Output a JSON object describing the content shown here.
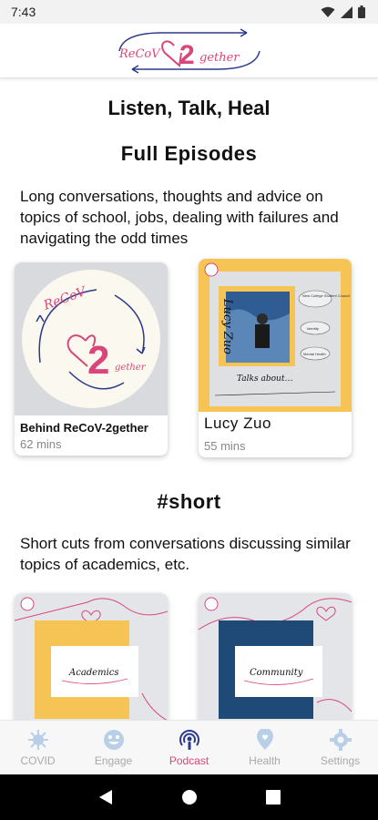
{
  "status_bar": {
    "time": "7:43"
  },
  "header": {
    "logo_left": "ReCoV",
    "logo_num": "2",
    "logo_right": "gether"
  },
  "main": {
    "title": "Listen, Talk, Heal",
    "full_episodes": {
      "heading": "Full Episodes",
      "description": "Long conversations, thoughts and advice on topics of school, jobs, dealing with failures and navigating the odd times",
      "cards": [
        {
          "title": "Behind ReCoV-2gether",
          "duration": "62 mins",
          "art_left": "ReCoV",
          "art_num": "2",
          "art_right": "gether"
        },
        {
          "title": "Lucy Zuo",
          "duration": "55 mins",
          "art_name": "Lucy Zuo",
          "art_caption": "Talks about…",
          "art_bubbles": [
            "New College Student Council",
            "Identity",
            "Mental Health"
          ]
        }
      ]
    },
    "short": {
      "heading": "#short",
      "description": "Short cuts from conversations discussing similar topics of academics, etc.",
      "cards": [
        {
          "label": "Academics",
          "accent": "#f6c455"
        },
        {
          "label": "Community",
          "accent": "#1f4a78"
        }
      ]
    }
  },
  "bottom_nav": {
    "items": [
      {
        "label": "COVID",
        "icon": "virus-icon",
        "active": false
      },
      {
        "label": "Engage",
        "icon": "emoji-icon",
        "active": false
      },
      {
        "label": "Podcast",
        "icon": "podcast-icon",
        "active": true
      },
      {
        "label": "Health",
        "icon": "health-icon",
        "active": false
      },
      {
        "label": "Settings",
        "icon": "gear-icon",
        "active": false
      }
    ]
  },
  "colors": {
    "brand_pink": "#d9477a",
    "brand_navy": "#2b3a8c",
    "card_yellow": "#f6c455",
    "inactive_gray": "#a9a9a9"
  }
}
